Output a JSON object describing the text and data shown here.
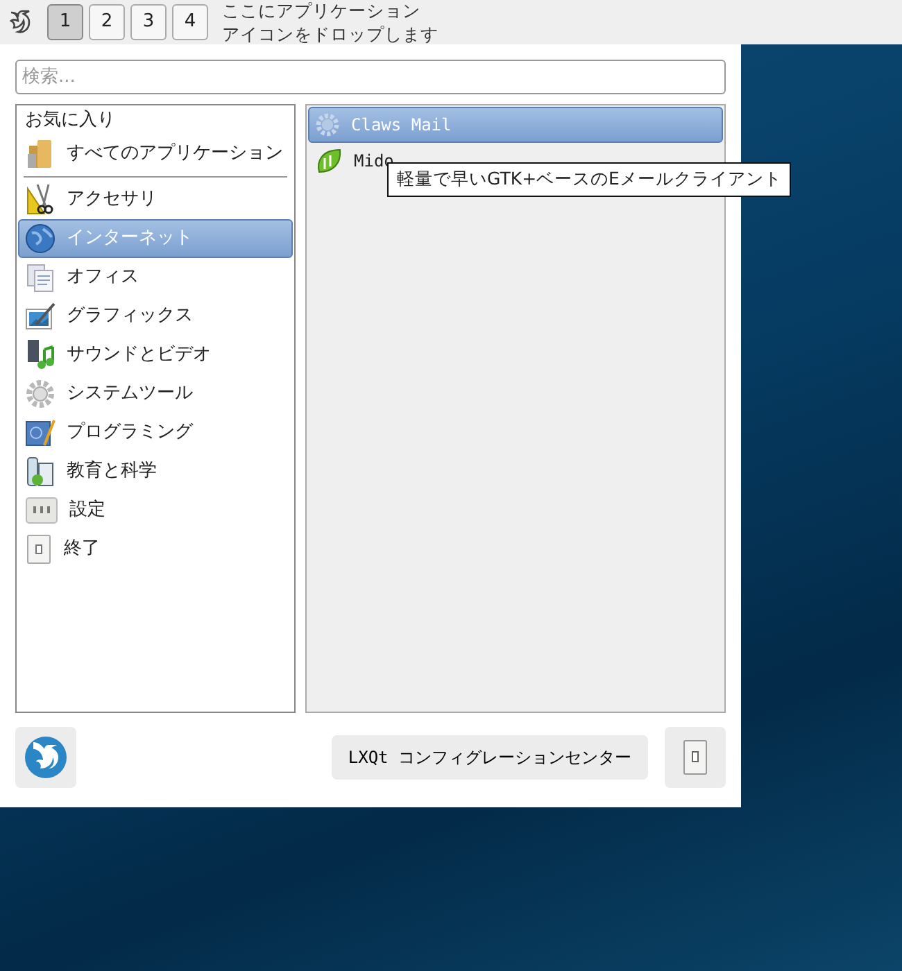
{
  "panel": {
    "desktops": [
      {
        "label": "1",
        "selected": true
      },
      {
        "label": "2",
        "selected": false
      },
      {
        "label": "3",
        "selected": false
      },
      {
        "label": "4",
        "selected": false
      }
    ],
    "drop_hint": [
      "ここにアプリケーション",
      "アイコンをドロップします"
    ]
  },
  "menu": {
    "search": {
      "placeholder": "検索..."
    },
    "categories": [
      {
        "kind": "header",
        "label": "お気に入り"
      },
      {
        "kind": "all",
        "label": "すべてのアプリケーション",
        "selected": false
      },
      {
        "kind": "separator"
      },
      {
        "kind": "accessories",
        "label": "アクセサリ",
        "selected": false
      },
      {
        "kind": "internet",
        "label": "インターネット",
        "selected": true
      },
      {
        "kind": "office",
        "label": "オフィス",
        "selected": false
      },
      {
        "kind": "graphics",
        "label": "グラフィックス",
        "selected": false
      },
      {
        "kind": "multimedia",
        "label": "サウンドとビデオ",
        "selected": false
      },
      {
        "kind": "system",
        "label": "システムツール",
        "selected": false
      },
      {
        "kind": "development",
        "label": "プログラミング",
        "selected": false
      },
      {
        "kind": "education",
        "label": "教育と科学",
        "selected": false
      },
      {
        "kind": "settings",
        "label": "設定",
        "selected": false
      },
      {
        "kind": "leave",
        "label": "終了",
        "selected": false
      }
    ],
    "apps": [
      {
        "kind": "mail",
        "label": "Claws Mail",
        "selected": true
      },
      {
        "kind": "browser",
        "label": "Mido",
        "selected": false
      }
    ],
    "tooltip": "軽量で早いGTK+ベースのEメールクライアント",
    "config_button": "LXQt コンフィグレーションセンター"
  }
}
